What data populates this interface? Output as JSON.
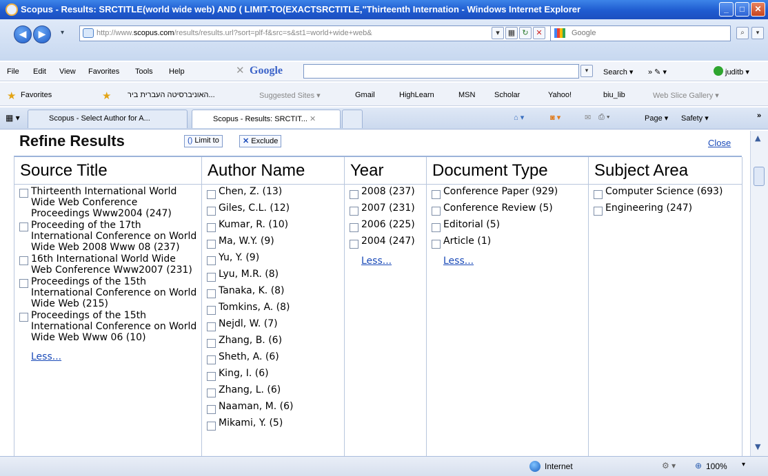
{
  "window": {
    "title": "Scopus - Results: SRCTITLE(world wide web) AND ( LIMIT-TO(EXACTSRCTITLE,\"Thirteenth Internation - Windows Internet Explorer",
    "min": "_",
    "max": "□",
    "close": "✕"
  },
  "nav": {
    "back": "◀",
    "forward": "▶",
    "address_host": "http://www.",
    "address_bold": "scopus.com",
    "address_rest": "/results/results.url?sort=plf-f&src=s&st1=world+wide+web&",
    "search_placeholder": "Google"
  },
  "menu": {
    "items": [
      "File",
      "Edit",
      "View",
      "Favorites",
      "Tools",
      "Help"
    ],
    "google_label": "Google",
    "search_label": "Search ▾",
    "user_label": "juditb ▾"
  },
  "favorites": {
    "label": "Favorites",
    "items": [
      "האוניברסיטה העברית ביר...",
      "Suggested Sites ▾",
      "Gmail",
      "HighLearn",
      "MSN",
      "Scholar",
      "Yahoo!",
      "biu_lib",
      "Web Slice Gallery ▾"
    ]
  },
  "tabs": [
    {
      "label": "Scopus - Select Author for A..."
    },
    {
      "label": "Scopus - Results: SRCTIT..."
    }
  ],
  "toolbar_right": {
    "page": "Page ▾",
    "safety": "Safety ▾"
  },
  "panel": {
    "title": "Refine Results",
    "limit_to": "Limit to",
    "exclude": "Exclude",
    "close": "Close"
  },
  "columns": {
    "source_title": {
      "header": "Source Title",
      "items": [
        "Thirteenth International World Wide Web Conference Proceedings Www2004 (247)",
        "Proceeding of the 17th International Conference on World Wide Web 2008 Www 08 (237)",
        "16th International World Wide Web Conference Www2007 (231)",
        "Proceedings of the 15th International Conference on World Wide Web (215)",
        "Proceedings of the 15th International Conference on World Wide Web Www 06 (10)"
      ],
      "less": "Less..."
    },
    "author_name": {
      "header": "Author Name",
      "items": [
        "Chen, Z. (13)",
        "Giles, C.L. (12)",
        "Kumar, R. (10)",
        "Ma, W.Y. (9)",
        "Yu, Y. (9)",
        "Lyu, M.R. (8)",
        "Tanaka, K. (8)",
        "Tomkins, A. (8)",
        "Nejdl, W. (7)",
        "Zhang, B. (6)",
        "Sheth, A. (6)",
        "King, I. (6)",
        "Zhang, L. (6)",
        "Naaman, M. (6)",
        "Mikami, Y. (5)"
      ]
    },
    "year": {
      "header": "Year",
      "items": [
        "2008 (237)",
        "2007 (231)",
        "2006 (225)",
        "2004 (247)"
      ],
      "less": "Less..."
    },
    "document_type": {
      "header": "Document Type",
      "items": [
        "Conference Paper (929)",
        "Conference Review (5)",
        "Editorial (5)",
        "Article (1)"
      ],
      "less": "Less..."
    },
    "subject_area": {
      "header": "Subject Area",
      "items": [
        "Computer Science (693)",
        "Engineering (247)"
      ]
    }
  },
  "status": {
    "zone": "Internet",
    "zoom": "100%"
  }
}
